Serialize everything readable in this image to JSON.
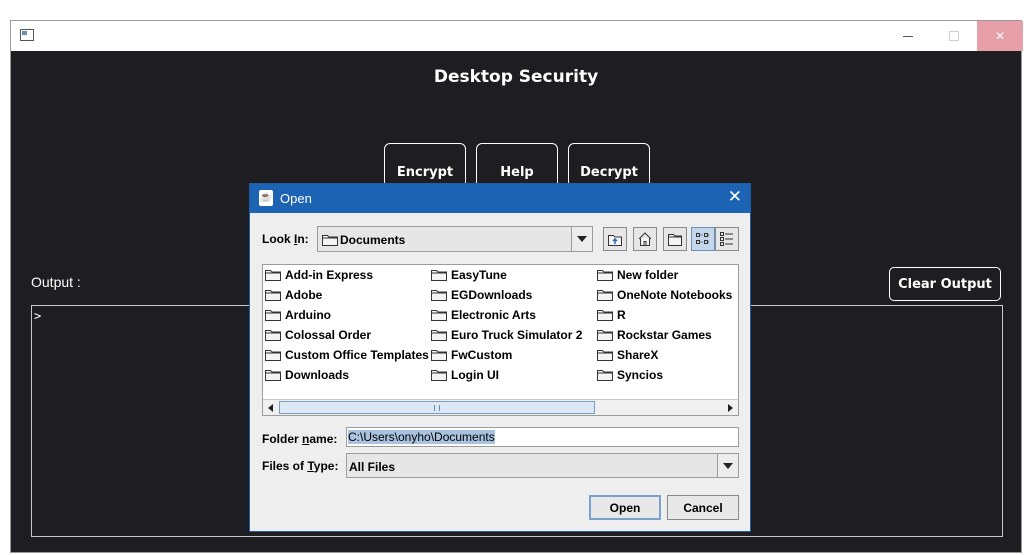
{
  "main": {
    "title": "Desktop Security",
    "buttons": {
      "encrypt": "Encrypt",
      "help": "Help",
      "decrypt": "Decrypt"
    },
    "output_label": "Output :",
    "clear_button": "Clear Output",
    "output_text": ">"
  },
  "dialog": {
    "title": "Open",
    "look_in_label_pre": "Look ",
    "look_in_label_ul": "I",
    "look_in_label_post": "n:",
    "look_in_value": "Documents",
    "files": [
      [
        "Add-in Express",
        "Adobe",
        "Arduino",
        "Colossal Order",
        "Custom Office Templates",
        "Downloads"
      ],
      [
        "EasyTune",
        "EGDownloads",
        "Electronic Arts",
        "Euro Truck Simulator 2",
        "FwCustom",
        "Login UI"
      ],
      [
        "New folder",
        "OneNote Notebooks",
        "R",
        "Rockstar Games",
        "ShareX",
        "Syncios"
      ]
    ],
    "folder_name_label_pre": "Folder ",
    "folder_name_label_ul": "n",
    "folder_name_label_post": "ame:",
    "folder_name_value": "C:\\Users\\onyho\\Documents",
    "files_of_type_label_pre": "Files of ",
    "files_of_type_label_ul": "T",
    "files_of_type_label_post": "ype:",
    "files_of_type_value": "All Files",
    "open_button": "Open",
    "cancel_button": "Cancel"
  },
  "colors": {
    "app_bg": "#1e1e22",
    "dialog_title_bg": "#1c63b3",
    "selection": "#a9c2e0"
  }
}
